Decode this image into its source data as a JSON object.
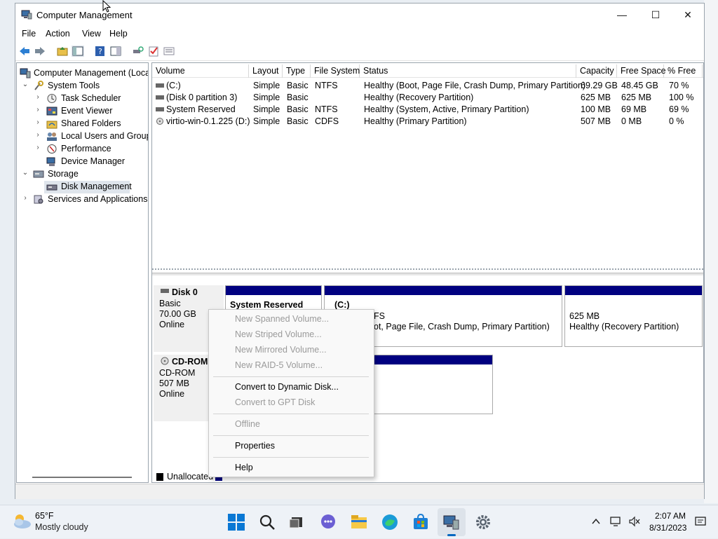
{
  "window": {
    "title": "Computer Management",
    "min": "—",
    "max": "☐",
    "close": "✕"
  },
  "menu": [
    "File",
    "Action",
    "View",
    "Help"
  ],
  "tree": {
    "root": "Computer Management (Local",
    "system_tools": "System Tools",
    "task_scheduler": "Task Scheduler",
    "event_viewer": "Event Viewer",
    "shared_folders": "Shared Folders",
    "local_users": "Local Users and Groups",
    "performance": "Performance",
    "device_manager": "Device Manager",
    "storage": "Storage",
    "disk_management": "Disk Management",
    "services": "Services and Applications"
  },
  "volume_list": {
    "headers": [
      "Volume",
      "Layout",
      "Type",
      "File System",
      "Status",
      "Capacity",
      "Free Space",
      "% Free"
    ],
    "rows": [
      [
        "(C:)",
        "Simple",
        "Basic",
        "NTFS",
        "Healthy (Boot, Page File, Crash Dump, Primary Partition)",
        "69.29 GB",
        "48.45 GB",
        "70 %"
      ],
      [
        "(Disk 0 partition 3)",
        "Simple",
        "Basic",
        "",
        "Healthy (Recovery Partition)",
        "625 MB",
        "625 MB",
        "100 %"
      ],
      [
        "System Reserved",
        "Simple",
        "Basic",
        "NTFS",
        "Healthy (System, Active, Primary Partition)",
        "100 MB",
        "69 MB",
        "69 %"
      ],
      [
        "virtio-win-0.1.225 (D:)",
        "Simple",
        "Basic",
        "CDFS",
        "Healthy (Primary Partition)",
        "507 MB",
        "0 MB",
        "0 %"
      ]
    ]
  },
  "disk0": {
    "name": "Disk 0",
    "type": "Basic",
    "size": "70.00 GB",
    "status": "Online",
    "part_system": "System Reserved",
    "part_c_title": "(C:)",
    "part_c_fs": "FS",
    "part_c_status": "ot, Page File, Crash Dump, Primary Partition)",
    "part_rec_size": "625 MB",
    "part_rec_status": "Healthy (Recovery Partition)"
  },
  "cdrom": {
    "name": "CD-ROM",
    "type": "CD-ROM",
    "size": "507 MB",
    "status": "Online"
  },
  "legend": {
    "unallocated": "Unallocated"
  },
  "context_menu": {
    "new_spanned": "New Spanned Volume...",
    "new_striped": "New Striped Volume...",
    "new_mirrored": "New Mirrored Volume...",
    "new_raid5": "New RAID-5 Volume...",
    "convert_dynamic": "Convert to Dynamic Disk...",
    "convert_gpt": "Convert to GPT Disk",
    "offline": "Offline",
    "properties": "Properties",
    "help": "Help"
  },
  "taskbar": {
    "temp": "65°F",
    "condition": "Mostly cloudy",
    "time": "2:07 AM",
    "date": "8/31/2023"
  },
  "colors": {
    "partition_bar": "#000080",
    "accent": "#0067c0"
  }
}
